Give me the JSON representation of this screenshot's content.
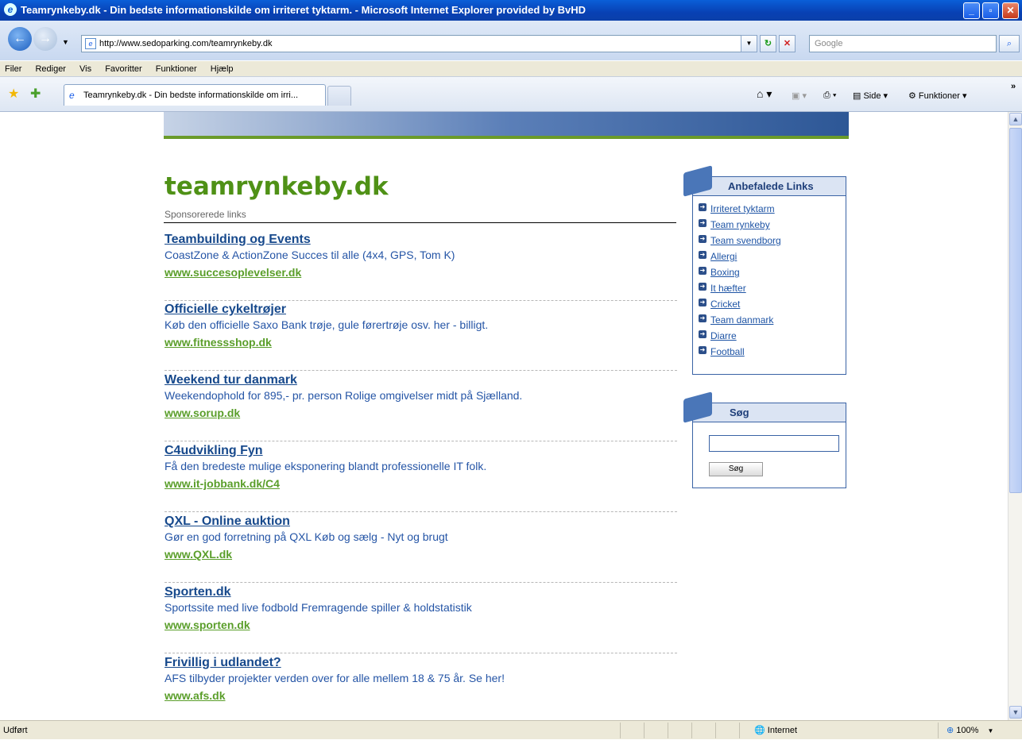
{
  "window": {
    "title": "Teamrynkeby.dk - Din bedste informationskilde om irriteret tyktarm. - Microsoft Internet Explorer provided by BvHD"
  },
  "address_bar": {
    "url": "http://www.sedoparking.com/teamrynkeby.dk"
  },
  "search_box": {
    "placeholder": "Google"
  },
  "menu": [
    "Filer",
    "Rediger",
    "Vis",
    "Favoritter",
    "Funktioner",
    "Hjælp"
  ],
  "tab": {
    "label": "Teamrynkeby.dk - Din bedste informationskilde om irri..."
  },
  "command_bar": {
    "side": "Side",
    "funktioner": "Funktioner"
  },
  "page": {
    "site_title": "teamrynkeby.dk",
    "sponsored_label": "Sponsorerede links",
    "ads": [
      {
        "title": "Teambuilding og Events",
        "desc": "CoastZone & ActionZone Succes til alle (4x4, GPS, Tom K)",
        "url": "www.succesoplevelser.dk"
      },
      {
        "title": "Officielle cykeltrøjer",
        "desc": "Køb den officielle Saxo Bank trøje, gule førertrøje osv. her - billigt.",
        "url": "www.fitnessshop.dk"
      },
      {
        "title": "Weekend tur danmark",
        "desc": "Weekendophold for 895,- pr. person Rolige omgivelser midt på Sjælland.",
        "url": "www.sorup.dk"
      },
      {
        "title": "C4udvikling Fyn",
        "desc": "Få den bredeste mulige eksponering blandt professionelle IT folk.",
        "url": "www.it-jobbank.dk/C4"
      },
      {
        "title": "QXL - Online auktion",
        "desc": "Gør en god forretning på QXL Køb og sælg - Nyt og brugt",
        "url": "www.QXL.dk"
      },
      {
        "title": "Sporten.dk",
        "desc": "Sportssite med live fodbold Fremragende spiller & holdstatistik",
        "url": "www.sporten.dk"
      },
      {
        "title": "Frivillig i udlandet?",
        "desc": "AFS tilbyder projekter verden over for alle mellem 18 & 75 år. Se her!",
        "url": "www.afs.dk"
      }
    ],
    "recommended": {
      "heading": "Anbefalede Links",
      "links": [
        "Irriteret tyktarm",
        "Team rynkeby",
        "Team svendborg",
        "Allergi",
        "Boxing",
        "It hæfter",
        "Cricket",
        "Team danmark",
        "Diarre",
        "Football"
      ]
    },
    "search": {
      "heading": "Søg",
      "button": "Søg",
      "value": ""
    }
  },
  "status_bar": {
    "left": "Udført",
    "zone": "Internet",
    "zoom": "100%"
  }
}
